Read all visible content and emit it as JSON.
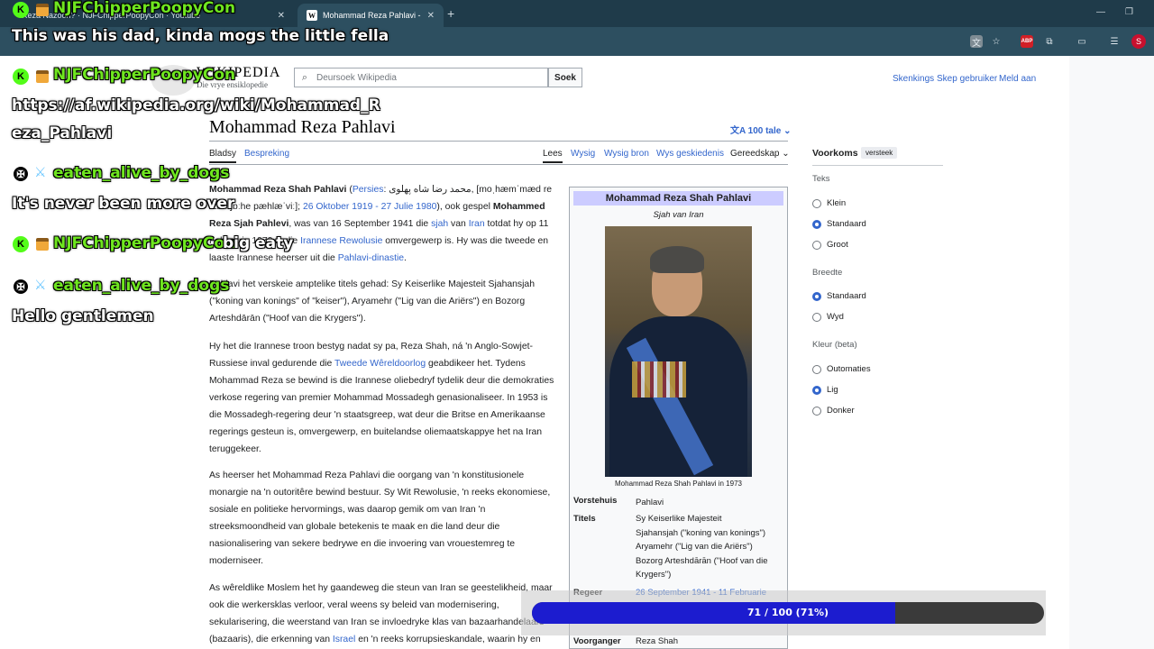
{
  "browser": {
    "tabs": [
      {
        "label": "Reza Nazoori? · NJFChipperPoopyCon · Youtube"
      },
      {
        "label": "Mohammad Reza Pahlavi - Wiki",
        "favicon": "W"
      }
    ],
    "new_tab": "+"
  },
  "wiki": {
    "wordmark": "WIKIPEDIA",
    "tagline": "Die vrye ensiklopedie",
    "search_placeholder": "Deursoek Wikipedia",
    "search_button": "Soek",
    "user_links": [
      "Skenkings",
      "Skep gebruiker",
      "Meld aan"
    ],
    "title": "Mohammad Reza Pahlavi",
    "languages": "100 tale",
    "tabs_left": [
      "Bladsy",
      "Bespreking"
    ],
    "tabs_right": [
      "Lees",
      "Wysig",
      "Wysig bron",
      "Wys geskiedenis",
      "Gereedskap"
    ],
    "p1": {
      "name": "Mohammad Reza Shah Pahlavi",
      "lang": "Persies",
      "persian": "محمد رضا شاه پهلوی",
      "ipa": ", [moˌhæmˈmæd reˈzɒː ˈʃɒːhe pæhlæˈviː];",
      "dates": "26 Oktober 1919 - 27 Julie 1980",
      "also": "), ook gespel",
      "alt": "Mohammed Reza Sjah Pahlevi",
      "rest1": ", was van 16 September 1941 die",
      "sjah": "sjah",
      "van": "van",
      "iran": "Iran",
      "rest2": "totdat hy op 11 Februarie 1979 in die",
      "rev": "Irannese Rewolusie",
      "rest3": "omvergewerp is. Hy was die tweede en laaste Irannese heerser uit die",
      "dyn": "Pahlavi-dinastie",
      "end": "."
    },
    "p2": "Pahlavi het verskeie amptelike titels gehad: Sy Keiserlike Majesteit Sjahansjah (\"koning van konings\" of \"keiser\"), Aryamehr (\"Lig van die Ariërs\") en Bozorg Arteshdārān (\"Hoof van die Krygers\").",
    "p3a": "Hy het die Irannese troon bestyg nadat sy pa, Reza Shah, ná 'n Anglo-Sowjet-Russiese inval gedurende die",
    "p3link": "Tweede Wêreldoorlog",
    "p3b": "geabdikeer het. Tydens Mohammad Reza se bewind is die Irannese oliebedryf tydelik deur die demokraties verkose regering van premier Mohammad Mossadegh genasionaliseer. In 1953 is die Mossadegh-regering deur 'n staatsgreep, wat deur die Britse en Amerikaanse regerings gesteun is, omvergewerp, en buitelandse oliemaatskappye het na Iran teruggekeer.",
    "p4": "As heerser het Mohammad Reza Pahlavi die oorgang van 'n konstitusionele monargie na 'n outoritêre bewind bestuur. Sy Wit Rewolusie, 'n reeks ekonomiese, sosiale en politieke hervormings, was daarop gemik om van Iran 'n streeksmoondheid van globale betekenis te maak en die land deur die nasionalisering van sekere bedrywe en die invoering van vrouestemreg te moderniseer.",
    "p5a": "As wêreldlike Moslem het hy gaandeweg die steun van Iran se geestelikheid, maar ook die werkersklas verloor, veral weens sy beleid van modernisering, sekularisering, die weerstand van Iran se invloedryke klas van bazaarhandelaars (bazaaris), die erkenning van",
    "p5link": "Israel",
    "p5b": "en 'n reeks korrupsieskandale, waarin hy en"
  },
  "infobox": {
    "title": "Mohammad Reza Shah Pahlavi",
    "subtitle": "Sjah van Iran",
    "caption": "Mohammad Reza Shah Pahlavi in 1973",
    "house_label": "Vorstehuis",
    "house_value": "Pahlavi",
    "titles_label": "Titels",
    "titles": [
      "Sy Keiserlike Majesteit",
      "Sjahansjah (\"koning van konings\")",
      "Aryamehr (\"Lig van die Ariërs\")",
      "Bozorg Arteshdārān (\"Hoof van die Krygers\")"
    ],
    "reign_label": "Regeer",
    "reign_value": "26 September 1941 - 11 Februarie",
    "pred_label": "Voorganger",
    "pred_value": "Reza Shah"
  },
  "appearance": {
    "title": "Voorkoms",
    "hide": "versteek",
    "text_label": "Teks",
    "text_options": [
      "Klein",
      "Standaard",
      "Groot"
    ],
    "text_selected": 1,
    "width_label": "Breedte",
    "width_options": [
      "Standaard",
      "Wyd"
    ],
    "width_selected": 0,
    "color_label": "Kleur (beta)",
    "color_options": [
      "Outomaties",
      "Lig",
      "Donker"
    ],
    "color_selected": 1
  },
  "overlay": {
    "top_user": "NJFChipperPoopyCon",
    "top_msg": "This was his dad, kinda mogs the little fella",
    "messages": [
      {
        "user": "NJFChipperPoopyCon",
        "text": "https://af.wikipedia.org/wiki/Mohammad_R",
        "text2": "eza_Pahlavi"
      },
      {
        "user": "eaten_alive_by_dogs",
        "text": "It's never been more over"
      },
      {
        "user": "NJFChipperPoopyCon",
        "text": "big eaty"
      },
      {
        "user": "eaten_alive_by_dogs",
        "text": "Hello gentlemen"
      }
    ]
  },
  "progress": {
    "label": "71 / 100 (71%)",
    "fraction": 0.71
  },
  "colors": {
    "link": "#3366cc",
    "progress_fill": "#1c1ccf",
    "chat_username": "#6fe61f",
    "infobox_title_bg": "#ccccff"
  }
}
